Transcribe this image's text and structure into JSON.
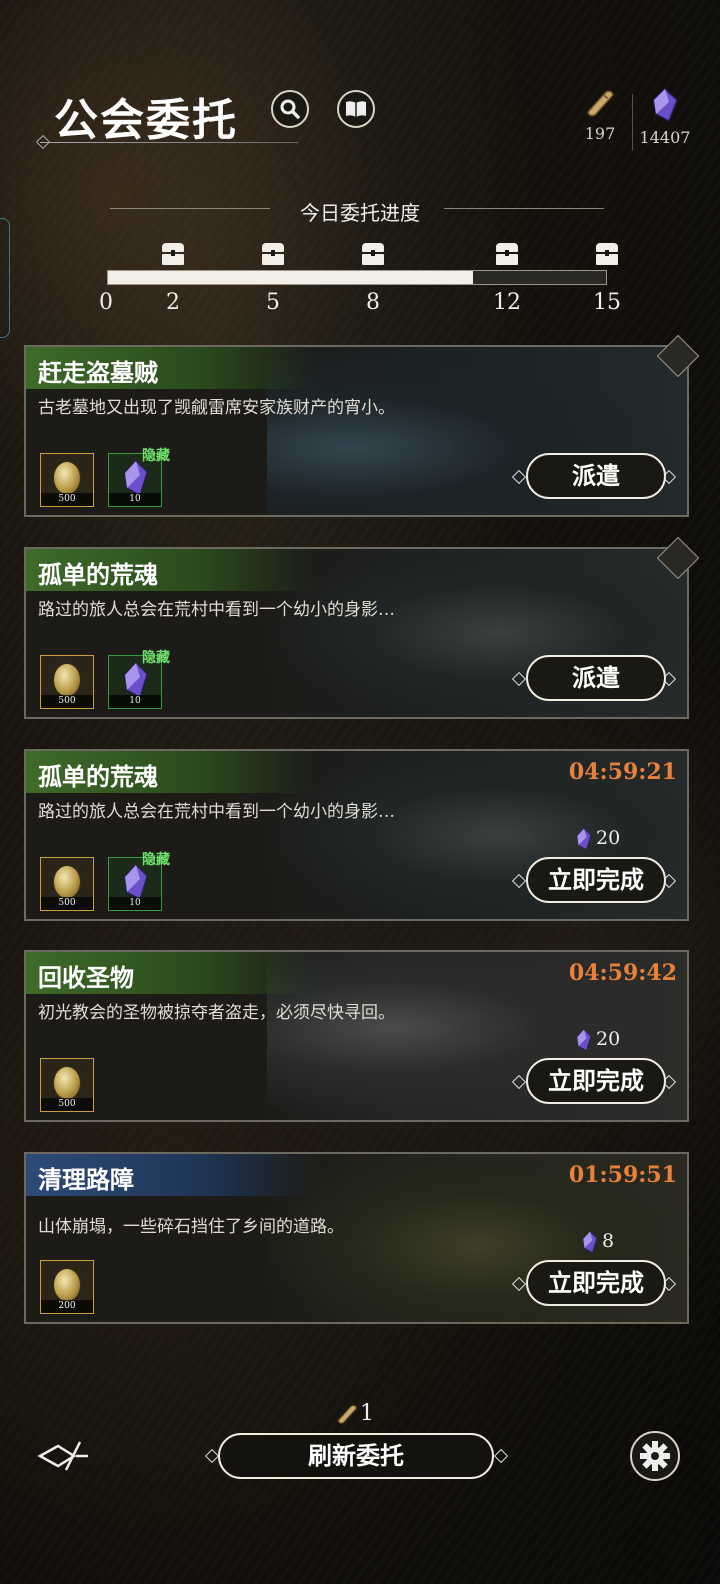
{
  "header": {
    "title": "公会委托",
    "scroll_count": "197",
    "crystal_count": "14407",
    "search_icon": "search-icon",
    "book_icon": "book-icon"
  },
  "progress": {
    "label": "今日委托进度",
    "current": 11,
    "max": 15,
    "ticks": [
      "0",
      "2",
      "5",
      "8",
      "12",
      "15"
    ]
  },
  "quests": [
    {
      "title": "赶走盗墓贼",
      "desc": "古老墓地又出现了觊觎雷席安家族财产的宵小。",
      "rewards": [
        {
          "type": "gold",
          "amount": "500"
        },
        {
          "type": "crystal",
          "amount": "10"
        }
      ],
      "hidden_label": "隐藏",
      "action": "派遣",
      "timer": "",
      "cost": ""
    },
    {
      "title": "孤单的荒魂",
      "desc": "路过的旅人总会在荒村中看到一个幼小的身影…",
      "rewards": [
        {
          "type": "gold",
          "amount": "500"
        },
        {
          "type": "crystal",
          "amount": "10"
        }
      ],
      "hidden_label": "隐藏",
      "action": "派遣",
      "timer": "",
      "cost": ""
    },
    {
      "title": "孤单的荒魂",
      "desc": "路过的旅人总会在荒村中看到一个幼小的身影…",
      "rewards": [
        {
          "type": "gold",
          "amount": "500"
        },
        {
          "type": "crystal",
          "amount": "10"
        }
      ],
      "hidden_label": "隐藏",
      "action": "立即完成",
      "timer": "04:59:21",
      "cost": "20"
    },
    {
      "title": "回收圣物",
      "desc": "初光教会的圣物被掠夺者盗走，必须尽快寻回。",
      "rewards": [
        {
          "type": "gold",
          "amount": "500"
        }
      ],
      "action": "立即完成",
      "timer": "04:59:42",
      "cost": "20"
    },
    {
      "title": "清理路障",
      "desc": "山体崩塌，一些碎石挡住了乡间的道路。",
      "rewards": [
        {
          "type": "gold",
          "amount": "200"
        }
      ],
      "action": "立即完成",
      "timer": "01:59:51",
      "cost": "8"
    }
  ],
  "footer": {
    "refresh_label": "刷新委托",
    "refresh_cost": "1"
  },
  "colors": {
    "timer": "#e8823a",
    "hidden": "#6fe06a",
    "green_title": "#3f6b2a",
    "blue_title": "#2d4b78"
  }
}
